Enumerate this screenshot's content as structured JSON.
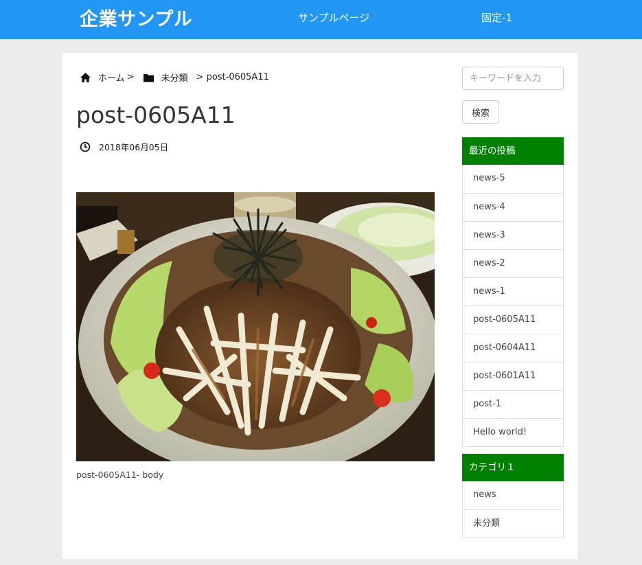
{
  "header": {
    "site_title": "企業サンプル",
    "nav": [
      "サンプルページ",
      "固定-1"
    ],
    "bg_color": "#2196f3"
  },
  "breadcrumb": {
    "home_icon": "home-icon",
    "home": "ホーム",
    "sep": ">",
    "folder_icon": "folder-icon",
    "category": "未分類",
    "current": "> post-0605A11"
  },
  "post": {
    "title": "post-0605A11",
    "clock_icon": "clock-icon",
    "date": "2018年06月05日",
    "image_subject": "salad-photo",
    "body": "post-0605A11- body"
  },
  "sidebar": {
    "search_placeholder": "キーワードを入力",
    "search_button": "検索",
    "accent_color": "#008000",
    "recent": {
      "title": "最近の投稿",
      "items": [
        "news-5",
        "news-4",
        "news-3",
        "news-2",
        "news-1",
        "post-0605A11",
        "post-0604A11",
        "post-0601A11",
        "post-1",
        "Hello world!"
      ]
    },
    "categories": {
      "title": "カテゴリ１",
      "items": [
        "news",
        "未分類"
      ]
    }
  }
}
